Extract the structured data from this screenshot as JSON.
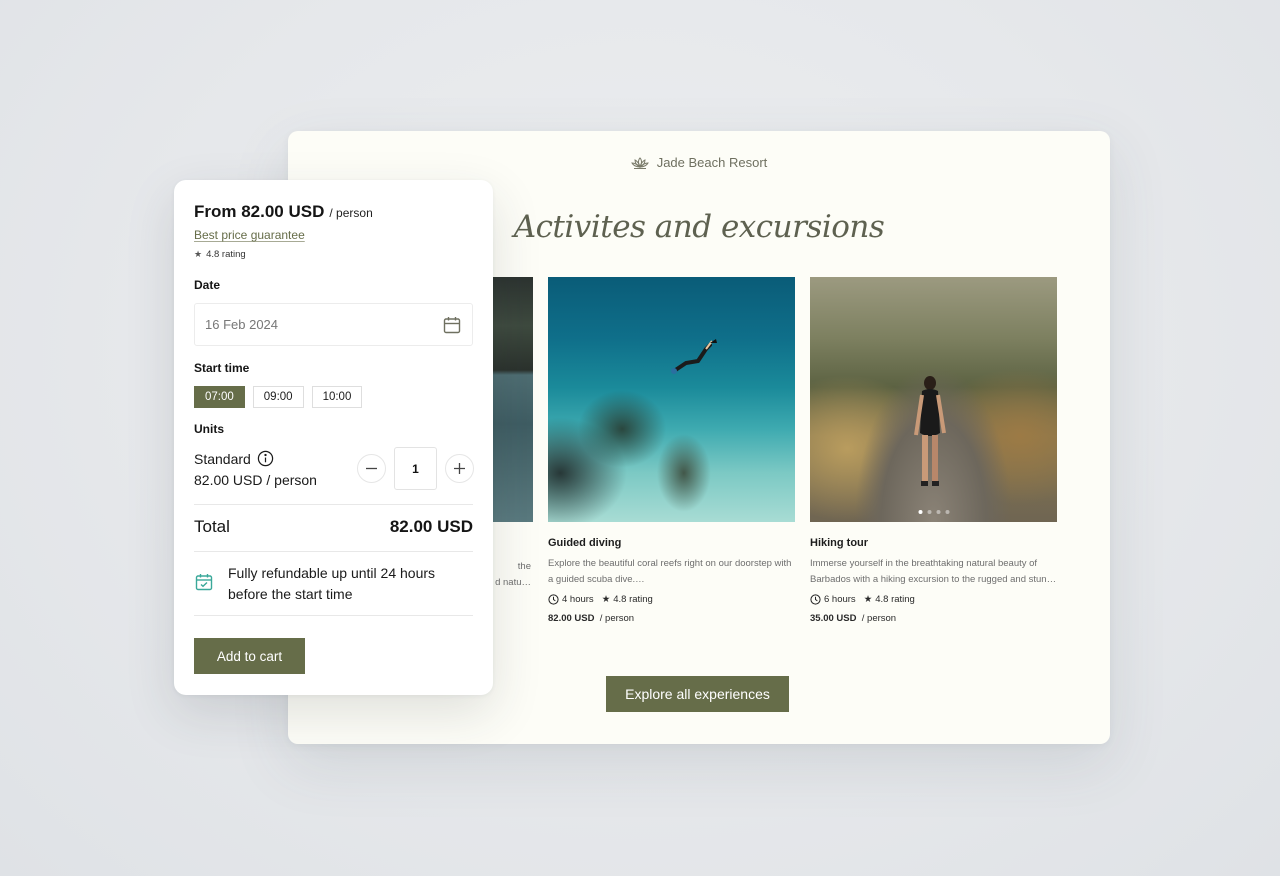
{
  "site": {
    "brand_name": "Jade Beach Resort",
    "brand_icon": "lotus-icon",
    "headline": "Activites and excursions",
    "cards": [
      {
        "title": "",
        "desc_visible_fragment_1": "the",
        "desc_visible_fragment_2": "d natu…",
        "image": "lake-photo"
      },
      {
        "title": "Guided diving",
        "description": "Explore the beautiful coral reefs right on our doorstep with a guided scuba dive.…",
        "duration": "4 hours",
        "rating": "4.8 rating",
        "price": "82.00 USD",
        "price_unit": "/ person",
        "image": "diving-photo"
      },
      {
        "title": "Hiking tour",
        "description": "Immerse yourself in the breathtaking natural beauty of Barbados with a hiking excursion to the rugged and stun…",
        "duration": "6 hours",
        "rating": "4.8 rating",
        "price": "35.00 USD",
        "price_unit": "/ person",
        "image": "hiking-photo",
        "carousel_total": 4,
        "carousel_active": 1
      }
    ],
    "explore_button": "Explore all experiences"
  },
  "booking": {
    "from_price": "From 82.00 USD",
    "from_unit": "/ person",
    "guarantee_link": "Best price guarantee",
    "rating": "4.8 rating",
    "date_label": "Date",
    "date_value": "16 Feb 2024",
    "start_time_label": "Start time",
    "times": [
      {
        "label": "07:00",
        "selected": true
      },
      {
        "label": "09:00",
        "selected": false
      },
      {
        "label": "10:00",
        "selected": false
      }
    ],
    "units_label": "Units",
    "unit_name": "Standard",
    "unit_price": "82.00 USD / person",
    "quantity": "1",
    "total_label": "Total",
    "total_value": "82.00 USD",
    "refund_text": "Fully refundable up until 24 hours before the start time",
    "add_to_cart": "Add to cart"
  },
  "colors": {
    "accent": "#666d49",
    "page_bg": "#fdfdf7",
    "refund_icon": "#3aa89a"
  }
}
